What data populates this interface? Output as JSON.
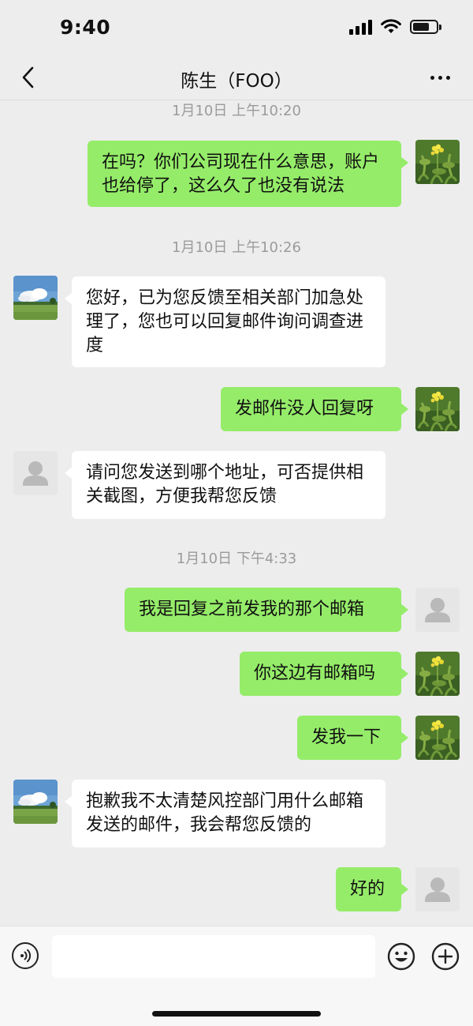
{
  "status_bar": {
    "time": "9:40",
    "icons": [
      "cellular-signal-icon",
      "wifi-icon",
      "battery-icon"
    ]
  },
  "nav": {
    "back_icon": "chevron-left-icon",
    "title": "陈生（FOO）",
    "more_icon": "more-icon"
  },
  "colors": {
    "background": "#ededed",
    "sent_bubble": "#95ec69",
    "received_bubble": "#ffffff",
    "timestamp_text": "#9b9b9b"
  },
  "timestamps": [
    "1月10日 上午10:20",
    "1月10日 上午10:26",
    "1月10日 下午4:33"
  ],
  "messages": [
    {
      "direction": "sent",
      "avatar": "rapeseed-flower-avatar",
      "text": "在吗？你们公司现在什么意思，账户也给停了，这么久了也没有说法"
    },
    {
      "direction": "received",
      "avatar": "landscape-avatar",
      "text": "您好，已为您反馈至相关部门加急处理了，您也可以回复邮件询问调查进度"
    },
    {
      "direction": "sent",
      "avatar": "rapeseed-flower-avatar",
      "text": "发邮件没人回复呀"
    },
    {
      "direction": "received",
      "avatar": "default-user-avatar",
      "text": "请问您发送到哪个地址，可否提供相关截图，方便我帮您反馈"
    },
    {
      "direction": "sent",
      "avatar": "default-user-avatar",
      "text": "我是回复之前发我的那个邮箱"
    },
    {
      "direction": "sent",
      "avatar": "rapeseed-flower-avatar",
      "text": "你这边有邮箱吗"
    },
    {
      "direction": "sent",
      "avatar": "rapeseed-flower-avatar",
      "text": "发我一下"
    },
    {
      "direction": "received",
      "avatar": "landscape-avatar",
      "text": "抱歉我不太清楚风控部门用什么邮箱发送的邮件，我会帮您反馈的"
    },
    {
      "direction": "sent",
      "avatar": "default-user-avatar",
      "text": "好的"
    }
  ],
  "input_bar": {
    "value": "",
    "icons": [
      "voice-icon",
      "emoji-icon",
      "plus-icon"
    ]
  }
}
